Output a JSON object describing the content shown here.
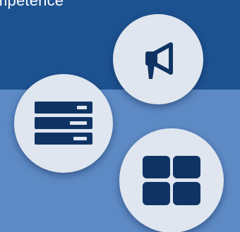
{
  "header": {
    "title": "mpetence"
  },
  "icons": {
    "announce": "megaphone-icon",
    "list": "list-view-icon",
    "grid": "grid-view-icon"
  },
  "colors": {
    "top_band": "#1d5290",
    "bottom_band": "#5d8ac5",
    "circle_bg": "#dfe6ef",
    "icon": "#0f3463"
  }
}
